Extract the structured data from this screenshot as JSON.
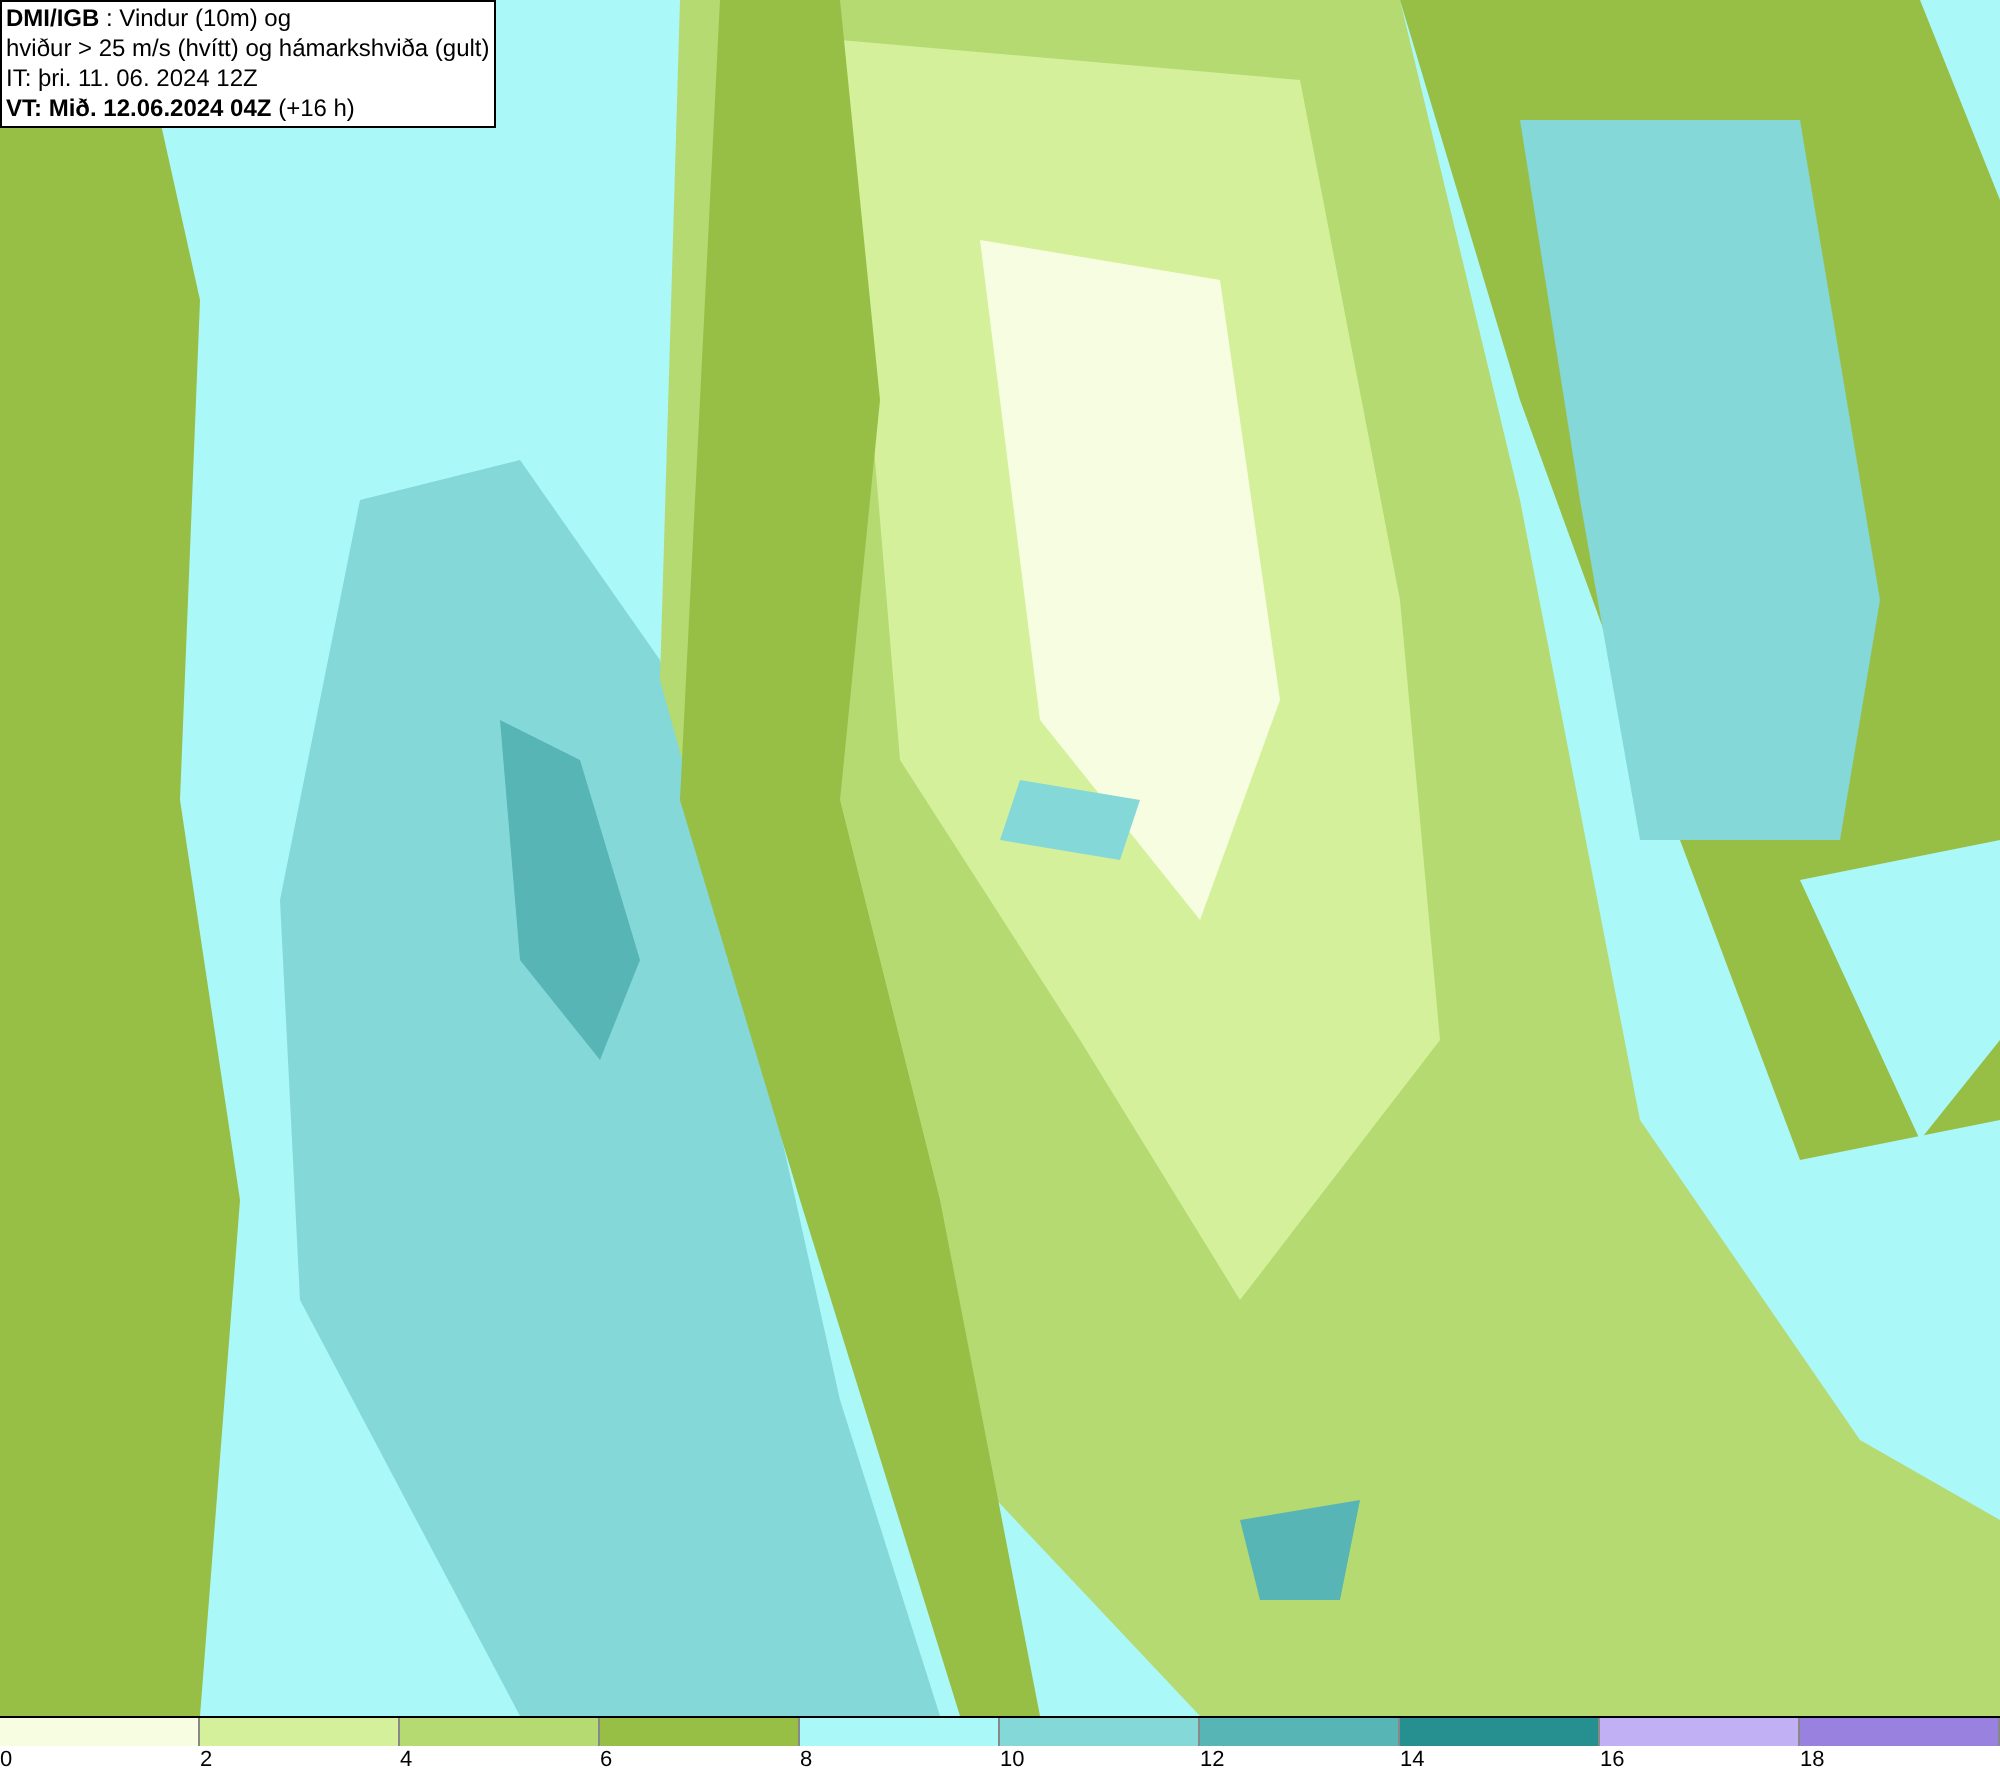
{
  "header": {
    "lines": [
      "**DMI/IGB** : Vindur (10m) og",
      "hviður > 25 m/s (hvítt) og hámarkshviða (gult)",
      "IT: þri. 11. 06. 2024 12Z",
      "**VT: Mið. 12.06.2024 04Z** (+16 h)"
    ]
  },
  "legend": {
    "bins": [
      {
        "label": "0",
        "color": "#f7fde0"
      },
      {
        "label": "2",
        "color": "#d4f09a"
      },
      {
        "label": "4",
        "color": "#b5da72"
      },
      {
        "label": "6",
        "color": "#97be45"
      },
      {
        "label": "8",
        "color": "#abf8f8"
      },
      {
        "label": "10",
        "color": "#84d8d8"
      },
      {
        "label": "12",
        "color": "#58b5b5"
      },
      {
        "label": "14",
        "color": "#268f8f"
      },
      {
        "label": "16",
        "color": "#c2b0f5"
      },
      {
        "label": "18",
        "color": "#9982df"
      }
    ]
  }
}
